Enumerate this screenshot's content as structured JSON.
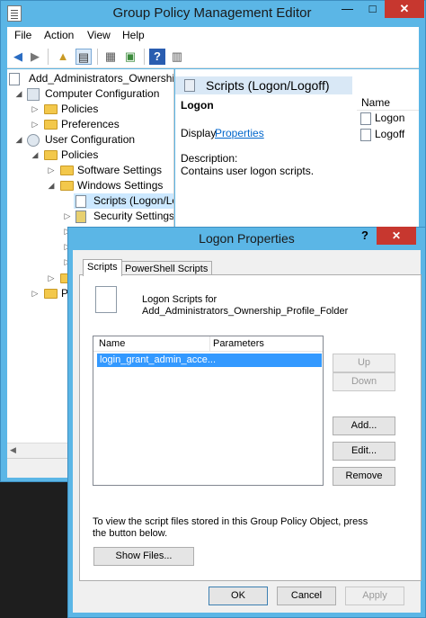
{
  "main_window": {
    "title": "Group Policy Management Editor",
    "min_glyph": "—",
    "max_glyph": "□",
    "close_glyph": "✕"
  },
  "menu": [
    "File",
    "Action",
    "View",
    "Help"
  ],
  "tree": {
    "root": "Add_Administrators_Ownership_Profile_Folder",
    "computer_config": "Computer Configuration",
    "cc_policies": "Policies",
    "cc_preferences": "Preferences",
    "user_config": "User Configuration",
    "uc_policies": "Policies",
    "software_settings": "Software Settings",
    "windows_settings": "Windows Settings",
    "scripts": "Scripts (Logon/Logoff)",
    "security_settings": "Security Settings",
    "partial_item": "P"
  },
  "right_pane": {
    "header": "Scripts (Logon/Logoff)",
    "item_title": "Logon",
    "display_label": "Display",
    "properties_link": "Properties",
    "description_label": "Description:",
    "description": "Contains user logon scripts.",
    "list_header": "Name",
    "list_items": [
      "Logon",
      "Logoff"
    ]
  },
  "dialog": {
    "title": "Logon Properties",
    "help_glyph": "?",
    "close_glyph": "✕",
    "tabs": [
      "Scripts",
      "PowerShell Scripts"
    ],
    "caption_line1": "Logon Scripts for",
    "caption_line2": "Add_Administrators_Ownership_Profile_Folder",
    "list_columns": [
      "Name",
      "Parameters"
    ],
    "list_rows": [
      "login_grant_admin_acce..."
    ],
    "buttons": {
      "up": "Up",
      "down": "Down",
      "add": "Add...",
      "edit": "Edit...",
      "remove": "Remove",
      "show_files": "Show Files...",
      "ok": "OK",
      "cancel": "Cancel",
      "apply": "Apply"
    },
    "info_line1": "To view the script files stored in this Group Policy Object, press",
    "info_line2": "the button below."
  },
  "colors": {
    "title_bar": "#5bb6e6",
    "selection": "#3399ff",
    "link": "#0066cc",
    "close_button": "#c7372f"
  }
}
